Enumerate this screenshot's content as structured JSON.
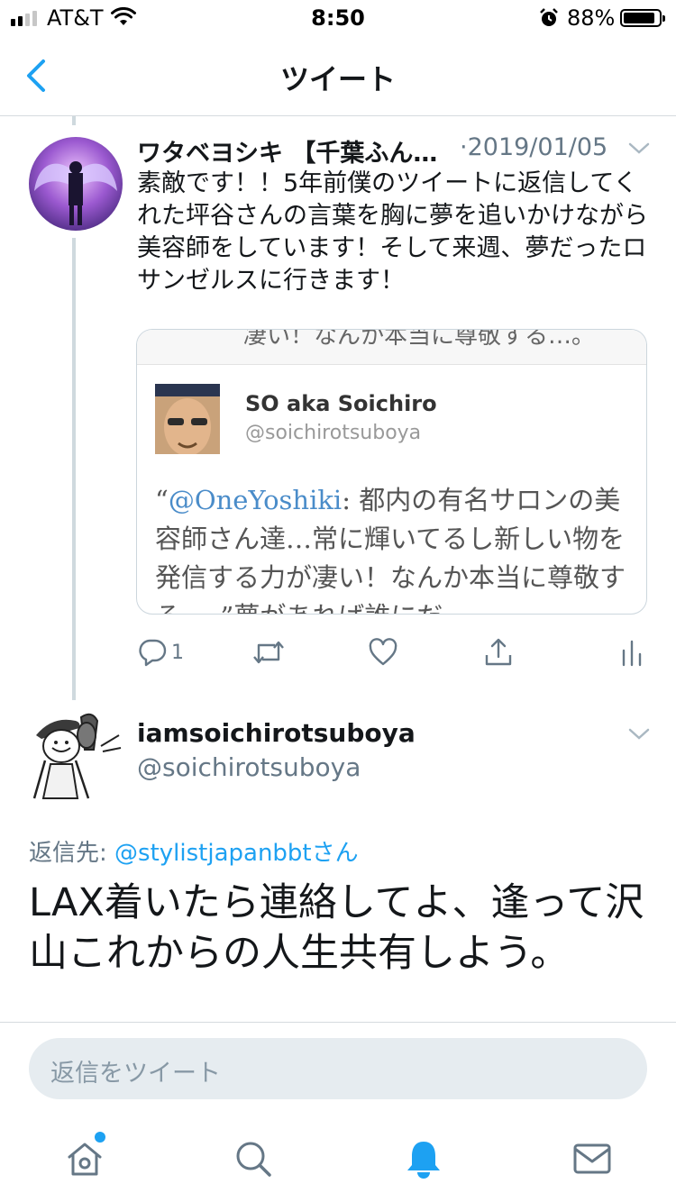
{
  "status_bar": {
    "carrier": "AT&T",
    "time": "8:50",
    "battery": "88%",
    "battery_level": 0.88,
    "signal_bars": 2
  },
  "nav": {
    "title": "ツイート"
  },
  "tweet1": {
    "display_name": "ワタベヨシキ 【千葉ふん…",
    "date": "·2019/01/05",
    "text": "素敵です！！5年前僕のツイートに返信してくれた坪谷さんの言葉を胸に夢を追いかけながら美容師をしています！そして来週、夢だったロサンゼルスに行きます！",
    "reply_count": "1",
    "card": {
      "top_text": "凄い！なんか本当に尊敬する…。",
      "name": "SO aka Soichiro",
      "handle": "@soichirotsuboya",
      "quote_open": "“",
      "quote_mention": "@OneYoshiki",
      "quote_text": ": 都内の有名サロンの美容師さん達…常に輝いてるし新しい物を発信する力が凄い！なんか本当に尊敬する…。”夢があれば誰にだ"
    }
  },
  "tweet2": {
    "display_name": "iamsoichirotsuboya",
    "handle": "@soichirotsuboya",
    "replying_label": "返信先: ",
    "replying_mention": "@stylistjapanbbt",
    "replying_suffix": "さん",
    "text": "LAX着いたら連絡してよ、逢って沢山これからの人生共有しよう。"
  },
  "reply_bar": {
    "placeholder": "返信をツイート"
  },
  "tabs": [
    "home",
    "search",
    "notifications",
    "messages"
  ],
  "colors": {
    "accent": "#1da1f2",
    "secondary_text": "#657786",
    "divider": "#d6dbdf"
  }
}
